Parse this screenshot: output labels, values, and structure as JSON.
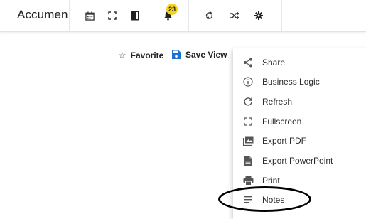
{
  "app": {
    "title": "Accumen"
  },
  "toolbar": {
    "notifications_count": "23",
    "buttons": [
      {
        "icon": "calendar-icon"
      },
      {
        "icon": "fullscreen-icon"
      },
      {
        "icon": "book-icon"
      },
      {
        "icon": "bell-icon"
      },
      {
        "icon": "sync-icon"
      },
      {
        "icon": "shuffle-icon"
      },
      {
        "icon": "gear-icon"
      }
    ]
  },
  "actions": {
    "favorite_label": "Favorite",
    "save_view_label": "Save View"
  },
  "menu": {
    "items": [
      {
        "label": "Share",
        "icon": "share-icon"
      },
      {
        "label": "Business Logic",
        "icon": "info-icon"
      },
      {
        "label": "Refresh",
        "icon": "refresh-icon"
      },
      {
        "label": "Fullscreen",
        "icon": "fullscreen-icon"
      },
      {
        "label": "Export PDF",
        "icon": "image-icon"
      },
      {
        "label": "Export PowerPoint",
        "icon": "document-icon"
      },
      {
        "label": "Print",
        "icon": "printer-icon"
      },
      {
        "label": "Notes",
        "icon": "notes-icon"
      }
    ]
  },
  "colors": {
    "accent": "#1f6fd1",
    "badge": "#f7d21c",
    "annotation": "#000000"
  }
}
